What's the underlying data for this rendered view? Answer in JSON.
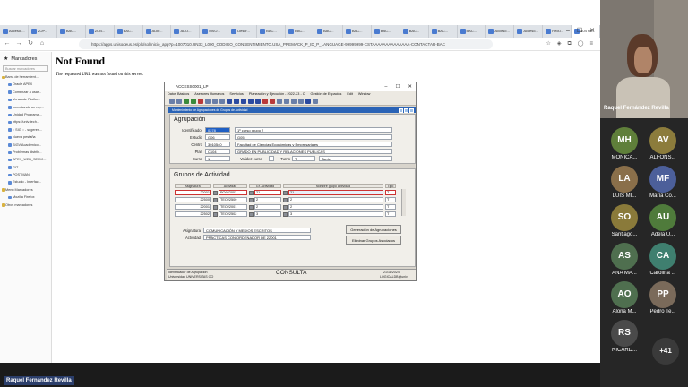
{
  "browser": {
    "tabs": [
      "Acceso ...",
      "ZOP...",
      "BAC...",
      "ZOB...",
      "BAC...",
      "ADIF...",
      "ADO...",
      "MSO...",
      "Descr...",
      "BAC...",
      "BAC...",
      "BAC...",
      "BAC...",
      "BAC...",
      "BAC...",
      "BAC...",
      "BAC...",
      "Acceso...",
      "Acceso...",
      "Recu...",
      "404 No..."
    ],
    "url": "https://apps.unisodeus.es/pls/sol/inicio_app?p=1007010.UN33_L000_CODIGO_CONSENTIMIENTO.USA_PREMACK_P_ID_P_LANGUAGE-99999999-CSTAAAAAAAAAAAAAA-CONTACTAR-BAC",
    "sidebar": {
      "title": "Marcadores",
      "search_placeholder": "Buscar marcadores",
      "items": [
        {
          "label": "Barra de herramient...",
          "kind": "folder"
        },
        {
          "label": "Oracle APEX",
          "kind": "sub"
        },
        {
          "label": "Comenzar a usar...",
          "kind": "sub"
        },
        {
          "label": "Veracode Platfor...",
          "kind": "sub"
        },
        {
          "label": "Incrustando un rep...",
          "kind": "sub"
        },
        {
          "label": "Unidad Programa...",
          "kind": "sub"
        },
        {
          "label": "https://univ-tech...",
          "kind": "sub"
        },
        {
          "label": ":: SIG :: - sugeren...",
          "kind": "sub"
        },
        {
          "label": "Nueva pestaña",
          "kind": "sub"
        },
        {
          "label": "SIGV Académico...",
          "kind": "sub"
        },
        {
          "label": "Problemas distrib...",
          "kind": "sub"
        },
        {
          "label": "APEX_WEB_SERVI...",
          "kind": "sub"
        },
        {
          "label": "GIT",
          "kind": "sub"
        },
        {
          "label": "POSTMAN",
          "kind": "sub"
        },
        {
          "label": "Estudio - Interfac...",
          "kind": "sub"
        },
        {
          "label": "Menú Marcadores",
          "kind": "folder"
        },
        {
          "label": "Mozilla Firefox",
          "kind": "sub"
        },
        {
          "label": "Otros marcadores",
          "kind": "folder"
        }
      ]
    },
    "page": {
      "title": "Not Found",
      "message": "The requested URL was not found on this server."
    }
  },
  "oracle": {
    "window_title": "ACCESS0001_LP",
    "menu": [
      "Datos Básicos",
      "Asesores Humanos",
      "Servicios",
      "Planeación y Ejecución - 2022-23 - C",
      "Gestión de Espacios",
      "Edit",
      "Window"
    ],
    "inner_title": "Mantenimiento de Agrupaciones de Grupos de Actividad",
    "agrupacion": {
      "section": "Agrupación",
      "identificador_label": "Identificador",
      "identificador": "0278",
      "identificador_desc": "1º curso grupo 2",
      "estudio_label": "Estudio",
      "estudio": "G06",
      "estudio_desc": "G05",
      "centro_label": "Centro",
      "centro": "3010540",
      "centro_desc": "Facultad de Ciencias Económicas y Empresariales",
      "plan_label": "Plan",
      "plan": "C104",
      "plan_desc": "GRADO EN PUBLICIDAD Y RELACIONES PUBLICAS",
      "curso_label": "Curso",
      "curso": "1",
      "validez_label": "Validez curso",
      "turno_label": "Turno",
      "turno": "T",
      "turno_desc": "Tarde"
    },
    "grupos": {
      "section": "Grupos de Actividad",
      "headers": [
        "Asignatura",
        "Actividad",
        "Gr. Actividad",
        "Nombre grupo actividad",
        "Tipo"
      ],
      "rows": [
        {
          "asignatura": "22001",
          "actividad": "PO922001",
          "gr": "21",
          "nombre": "21",
          "tipo": "T"
        },
        {
          "asignatura": "22500",
          "actividad": "TEO22500",
          "gr": "2",
          "nombre": "2",
          "tipo": "T"
        },
        {
          "asignatura": "22001",
          "actividad": "TEO22001",
          "gr": "2",
          "nombre": "2",
          "tipo": "T"
        },
        {
          "asignatura": "22502",
          "actividad": "TEO22502",
          "gr": "3",
          "nombre": "3",
          "tipo": "T"
        }
      ],
      "asignatura_label": "Asignatura",
      "asignatura_value": "COMUNICACIÓN Y MEDIOS ESCRITOS",
      "actividad_label": "Actividad",
      "actividad_value": "PRÁCTICAS CON ORDENADOR DE 22001",
      "btn_generacion": "Generación de Agrupaciones",
      "btn_eliminar": "Eliminar Grupos Asociados"
    },
    "status": {
      "left1": "Identificador de Agrupación",
      "left2": "Universidad UNIVERSITAS OO",
      "center": "CONSULTA",
      "right1": "21/11/2024",
      "right2": "LOGICALDB@univ"
    }
  },
  "call": {
    "presenter_name": "Raquel Fernández Revilla",
    "participants": [
      {
        "initials": "MH",
        "name": "MONICA...",
        "color": "#5f7f3a"
      },
      {
        "initials": "AV",
        "name": "ALFONS...",
        "color": "#8c7c3c"
      },
      {
        "initials": "LA",
        "name": "LUIS MI...",
        "color": "#8a6f4a"
      },
      {
        "initials": "MF",
        "name": "María Co...",
        "color": "#4c5f9a"
      },
      {
        "initials": "SO",
        "name": "Santiago...",
        "color": "#8a7a3a"
      },
      {
        "initials": "AU",
        "name": "Adela U...",
        "color": "#4f7b3b"
      },
      {
        "initials": "AS",
        "name": "ANA MA...",
        "color": "#4f6f4f"
      },
      {
        "initials": "CA",
        "name": "Carolina ...",
        "color": "#3f7f6f"
      },
      {
        "initials": "AO",
        "name": "Alona M...",
        "color": "#4f6f4f"
      },
      {
        "initials": "PP",
        "name": "Pedro Te...",
        "color": "#7a6a5a"
      },
      {
        "initials": "RS",
        "name": "RICARD...",
        "color": "#4a4a4a"
      }
    ],
    "more_count": "+41",
    "bottom_name": "Raquel Fernández Revilla"
  }
}
